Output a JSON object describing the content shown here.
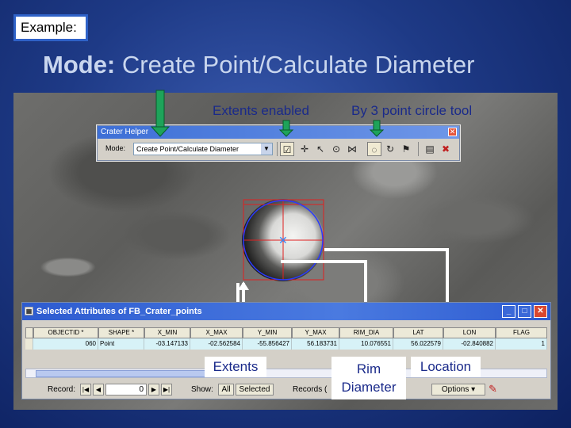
{
  "slide": {
    "example_label": "Example:",
    "title_prefix": "Mode:",
    "title_rest": " Create Point/Calculate Diameter",
    "annotations": {
      "extents_enabled": "Extents enabled",
      "three_point_tool": "By 3 point circle tool",
      "extents": "Extents",
      "rim_diameter_line1": "Rim",
      "rim_diameter_line2": "Diameter",
      "location": "Location"
    }
  },
  "colors": {
    "background": "#1e3a86",
    "arrow_green": "#1ea35a",
    "connector_white": "#ffffff",
    "annotation_text": "#1a2a8a",
    "circle_blue": "#2a3aff",
    "extent_red": "#e02020"
  },
  "crater_helper": {
    "title": "Crater Helper",
    "mode_label": "Mode:",
    "mode_value": "Create Point/Calculate Diameter",
    "close_icon": "close-icon",
    "tools": [
      {
        "name": "extents-toggle-icon",
        "glyph": "☑",
        "active": true
      },
      {
        "name": "add-point-icon",
        "glyph": "✛",
        "active": false
      },
      {
        "name": "pointer-icon",
        "glyph": "↖",
        "active": false
      },
      {
        "name": "target-icon",
        "glyph": "⊙",
        "active": false
      },
      {
        "name": "edit-vertex-icon",
        "glyph": "⋈",
        "active": false
      },
      {
        "name": "three-point-circle-icon",
        "glyph": "◌",
        "active": true
      },
      {
        "name": "rotate-icon",
        "glyph": "↻",
        "active": false
      },
      {
        "name": "flag-point-icon",
        "glyph": "⚑",
        "active": false
      },
      {
        "name": "save-icon",
        "glyph": "▤",
        "active": false
      },
      {
        "name": "delete-icon",
        "glyph": "✖",
        "active": false
      }
    ]
  },
  "attributes_window": {
    "title": "Selected Attributes of FB_Crater_points",
    "minimize_glyph": "_",
    "maximize_glyph": "□",
    "close_glyph": "✕",
    "columns": [
      "OBJECTID *",
      "SHAPE *",
      "X_MIN",
      "X_MAX",
      "Y_MIN",
      "Y_MAX",
      "RIM_DIA",
      "LAT",
      "LON",
      "FLAG"
    ],
    "rows": [
      [
        "060",
        "Point",
        "-03.147133",
        "-02.562584",
        "-55.856427",
        "56.183731",
        "10.076551",
        "56.022579",
        "-02.840882",
        "1"
      ]
    ],
    "status": {
      "record_label": "Record:",
      "record_value": "0",
      "show_label": "Show:",
      "all_button": "All",
      "selected_button": "Selected",
      "records_label": "Records (",
      "options_button": "Options",
      "first_glyph": "|◀",
      "prev_glyph": "◀",
      "next_glyph": "▶",
      "last_glyph": "▶|"
    }
  }
}
